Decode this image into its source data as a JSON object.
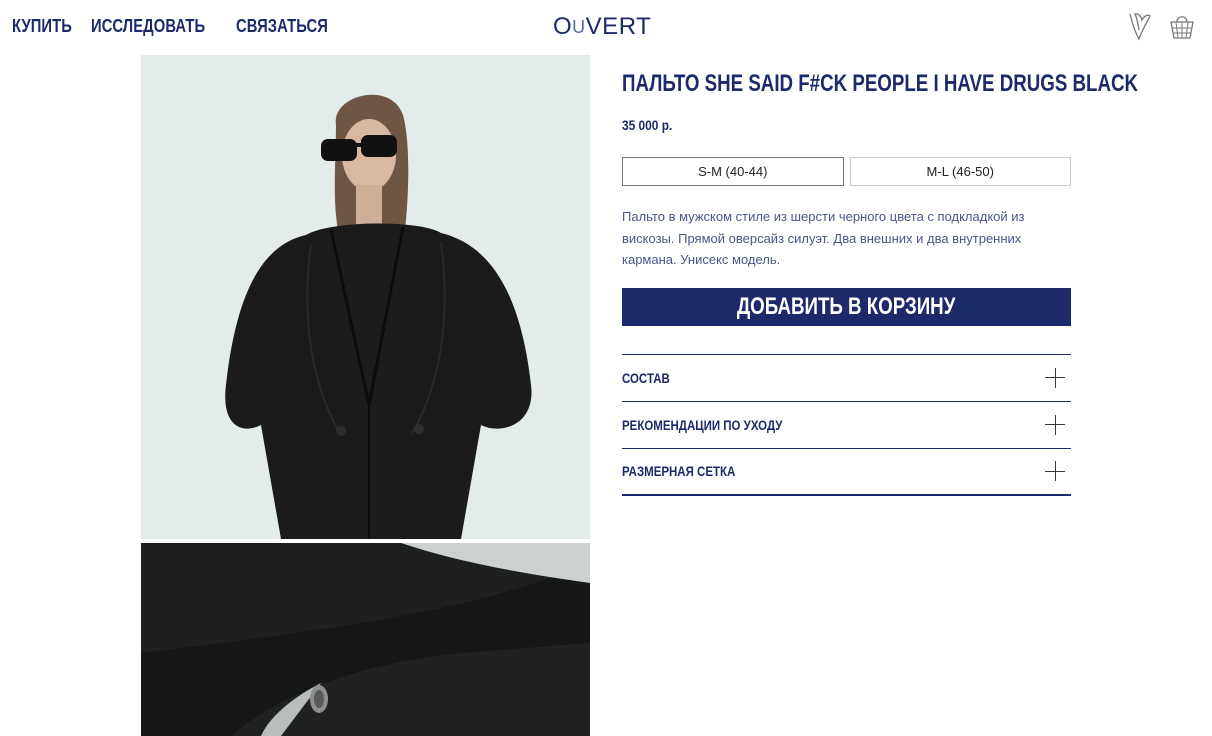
{
  "header": {
    "nav": [
      {
        "label": "КУПИТЬ"
      },
      {
        "label": "ИССЛЕДОВАТЬ"
      },
      {
        "label": "СВЯЗАТЬСЯ"
      }
    ],
    "logo_left": "O",
    "logo_mid": "U",
    "logo_right": "VERT",
    "icons": [
      "heart-icon",
      "basket-icon"
    ]
  },
  "gallery": {
    "images": [
      "model-wearing-black-coat",
      "coat-button-closeup"
    ]
  },
  "product": {
    "title": "ПАЛЬТО SHE SAID F#CK PEOPLE I HAVE DRUGS BLACK",
    "price": "35 000 р.",
    "sizes": [
      {
        "label": "S-M (40-44)",
        "selected": true
      },
      {
        "label": "M-L (46-50)",
        "selected": false
      }
    ],
    "description": "Пальто в мужском стиле из шерсти черного цвета с подкладкой из вискозы. Прямой оверсайз силуэт. Два внешних и два внутренних кармана. Унисекс модель.",
    "add_to_cart": "ДОБАВИТЬ В КОРЗИНУ",
    "accordion": [
      {
        "label": "СОСТАВ"
      },
      {
        "label": "РЕКОМЕНДАЦИИ ПО УХОДУ"
      },
      {
        "label": "РАЗМЕРНАЯ СЕТКА"
      }
    ]
  },
  "colors": {
    "brand": "#1c2a6b",
    "text_muted": "#4b5688"
  }
}
